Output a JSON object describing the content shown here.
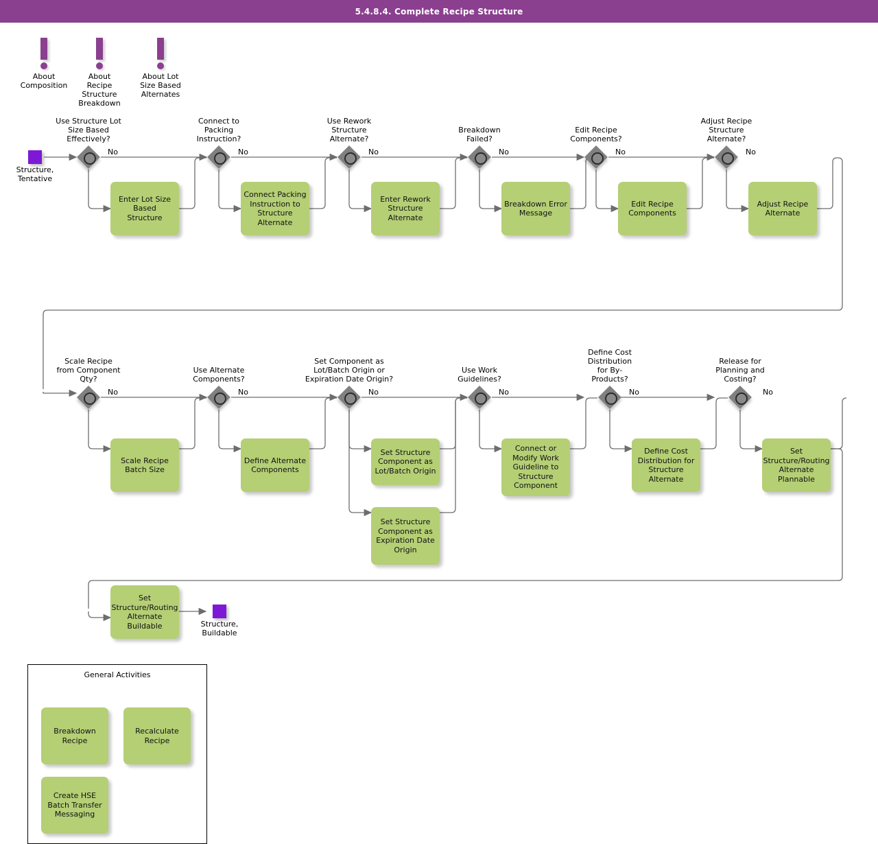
{
  "header": {
    "title": "5.4.8.4. Complete Recipe Structure",
    "bar_color": "#8b3f8f"
  },
  "palette": {
    "task_fill": "#b5cf75",
    "gateway_fill": "#808080",
    "data_object_fill": "#7d19d6",
    "connector": "#6d6d6d",
    "text": "#000000"
  },
  "info_markers": [
    {
      "label": "About\nComposition"
    },
    {
      "label": "About\nRecipe\nStructure\nBreakdown"
    },
    {
      "label": "About Lot\nSize Based\nAlternates"
    }
  ],
  "data_objects": [
    {
      "name": "start",
      "label": "Structure,\nTentative"
    },
    {
      "name": "end",
      "label": "Structure,\nBuildable"
    }
  ],
  "branch_label": "No",
  "gateways": [
    {
      "id": "g1",
      "label": "Use Structure Lot\nSize Based\nEffectively?"
    },
    {
      "id": "g2",
      "label": "Connect to\nPacking\nInstruction?"
    },
    {
      "id": "g3",
      "label": "Use Rework\nStructure\nAlternate?"
    },
    {
      "id": "g4",
      "label": "Breakdown\nFailed?"
    },
    {
      "id": "g5",
      "label": "Edit Recipe\nComponents?"
    },
    {
      "id": "g6",
      "label": "Adjust Recipe\nStructure\nAlternate?"
    },
    {
      "id": "g7",
      "label": "Scale Recipe\nfrom Component\nQty?"
    },
    {
      "id": "g8",
      "label": "Use Alternate\nComponents?"
    },
    {
      "id": "g9",
      "label": "Set Component as\nLot/Batch Origin or\nExpiration Date Origin?"
    },
    {
      "id": "g10",
      "label": "Use Work\nGuidelines?"
    },
    {
      "id": "g11",
      "label": "Define Cost\nDistribution\nfor By-\nProducts?"
    },
    {
      "id": "g12",
      "label": "Release for\nPlanning and\nCosting?"
    }
  ],
  "tasks": [
    {
      "id": "t1",
      "label": "Enter Lot Size\nBased\nStructure"
    },
    {
      "id": "t2",
      "label": "Connect Packing\nInstruction to\nStructure\nAlternate"
    },
    {
      "id": "t3",
      "label": "Enter Rework\nStructure\nAlternate"
    },
    {
      "id": "t4",
      "label": "Breakdown Error\nMessage"
    },
    {
      "id": "t5",
      "label": "Edit Recipe\nComponents"
    },
    {
      "id": "t6",
      "label": "Adjust Recipe\nAlternate"
    },
    {
      "id": "t7",
      "label": "Scale Recipe\nBatch Size"
    },
    {
      "id": "t8",
      "label": "Define Alternate\nComponents"
    },
    {
      "id": "t9",
      "label": "Set Structure\nComponent as\nLot/Batch Origin"
    },
    {
      "id": "t10",
      "label": "Set Structure\nComponent as\nExpiration Date\nOrigin"
    },
    {
      "id": "t11",
      "label": "Connect or\nModify Work\nGuideline to\nStructure\nComponent"
    },
    {
      "id": "t12",
      "label": "Define Cost\nDistribution for\nStructure\nAlternate"
    },
    {
      "id": "t13",
      "label": "Set\nStructure/Routing\nAlternate\nPlannable"
    },
    {
      "id": "t14",
      "label": "Set\nStructure/Routing\nAlternate\nBuildable"
    }
  ],
  "general_activities": {
    "title": "General Activities",
    "items": [
      {
        "id": "ga1",
        "label": "Breakdown\nRecipe"
      },
      {
        "id": "ga2",
        "label": "Recalculate\nRecipe"
      },
      {
        "id": "ga3",
        "label": "Create HSE\nBatch Transfer\nMessaging"
      }
    ]
  }
}
